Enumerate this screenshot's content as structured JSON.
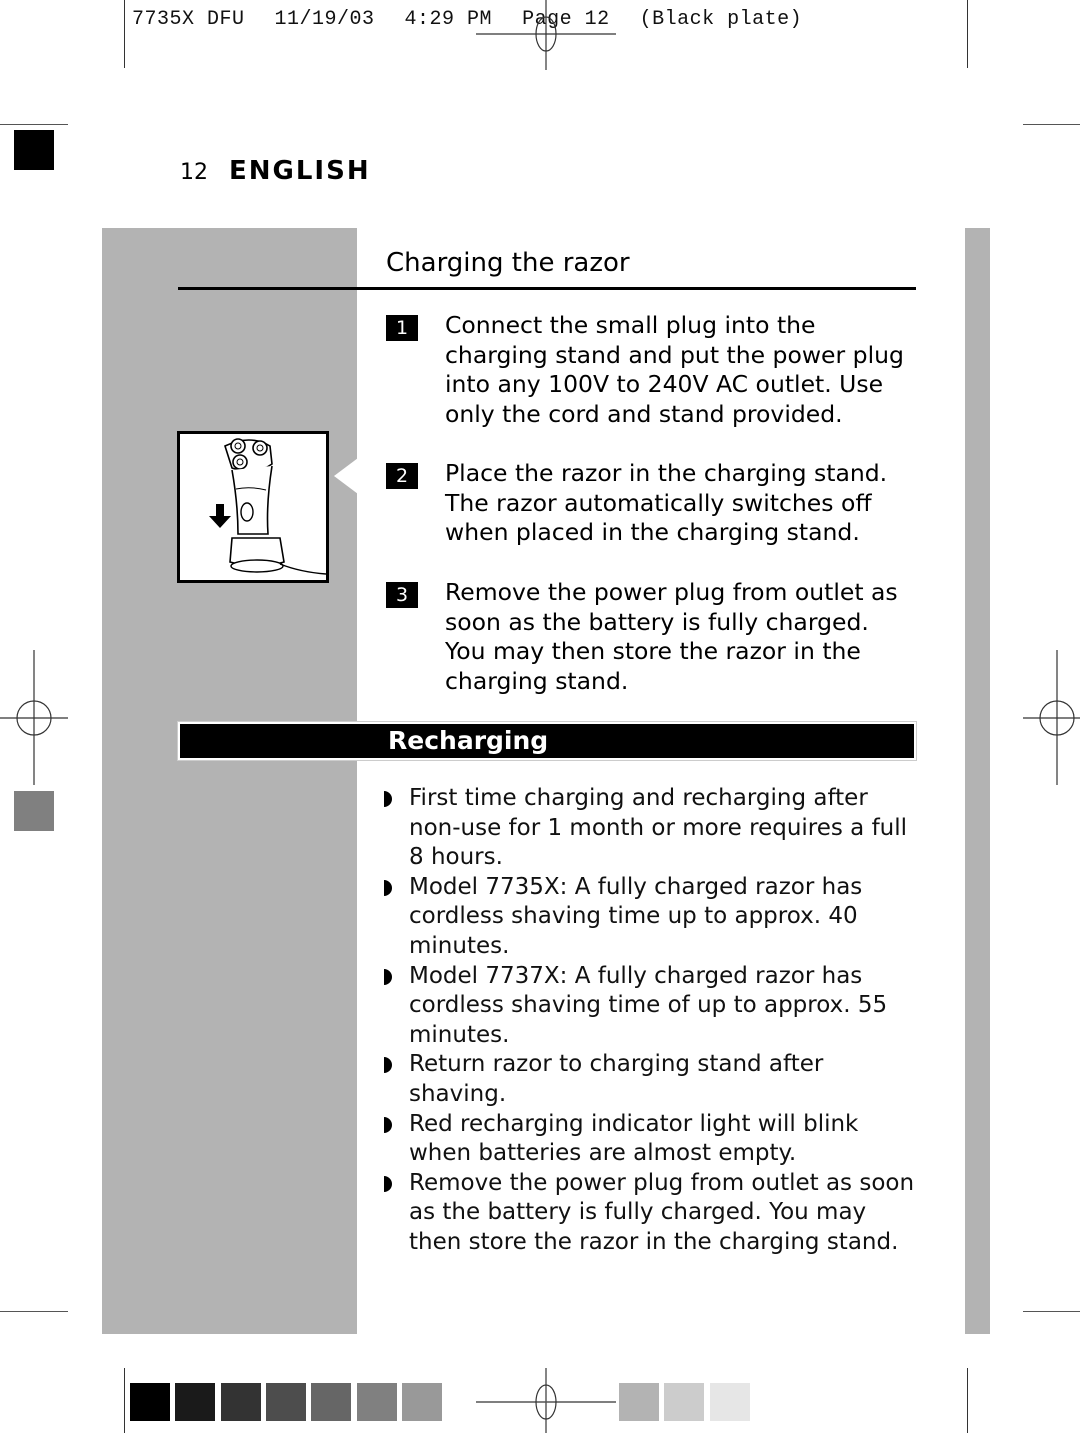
{
  "slug": {
    "job": "7735X DFU",
    "date": "11/19/03",
    "time": "4:29 PM",
    "page": "Page 12",
    "plate": "(Black plate)"
  },
  "header": {
    "page_number": "12",
    "language": "ENGLISH"
  },
  "charging": {
    "title": "Charging the razor",
    "steps": [
      {
        "num": "1",
        "text": "Connect the small plug into the charging stand and put the power plug into any 100V to 240V AC outlet. Use only the cord and stand provided."
      },
      {
        "num": "2",
        "text": "Place the razor in the charging stand. The razor automatically switches off when placed in the charging stand."
      },
      {
        "num": "3",
        "text": "Remove the power plug from outlet as soon as the battery is fully charged. You may then store the razor in the charging stand."
      }
    ],
    "illustration": "razor-in-charging-stand-icon"
  },
  "recharging": {
    "title": "Recharging",
    "bullets": [
      "First time charging and recharging after non-use for 1 month or more requires a full 8 hours.",
      "Model 7735X: A fully charged razor has cordless shaving time up to approx. 40 minutes.",
      "Model 7737X: A fully charged razor has cordless shaving time of up to approx. 55 minutes.",
      "Return razor to charging stand after shaving.",
      "Red recharging indicator light will blink when batteries are almost empty.",
      "Remove the power plug from outlet as soon as the battery is fully charged. You may then store the razor in the charging stand."
    ]
  },
  "color_bar": {
    "left": [
      "#000000",
      "#1a1a1a",
      "#333333",
      "#4d4d4d",
      "#666666",
      "#808080",
      "#999999"
    ],
    "right": [
      "#b3b3b3",
      "#cccccc",
      "#e6e6e6"
    ]
  },
  "colors": {
    "panel_gray": "#b3b3b3",
    "black_mark": "#000000",
    "gray_mark": "#808080"
  }
}
